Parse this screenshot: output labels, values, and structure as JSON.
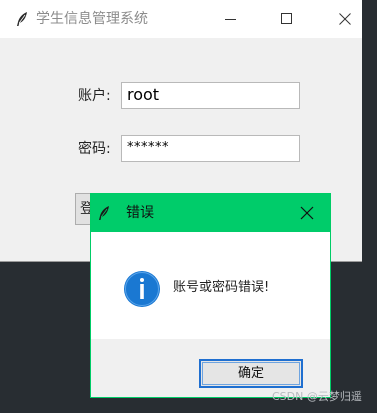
{
  "main_window": {
    "title": "学生信息管理系统",
    "username_label": "账户:",
    "username_value": "root",
    "password_label": "密码:",
    "password_value": "******",
    "login_button_label": "登",
    "icons": [
      "feather-icon",
      "minimize-icon",
      "maximize-icon",
      "close-icon"
    ]
  },
  "dialog": {
    "title": "错误",
    "message": "账号或密码错误!",
    "ok_label": "确定",
    "icons": [
      "feather-icon",
      "close-icon",
      "info-icon"
    ],
    "colors": {
      "titlebar": "#00cc6a",
      "info_icon": "#1a78d2"
    }
  },
  "watermark": "CSDN @云梦归遥"
}
